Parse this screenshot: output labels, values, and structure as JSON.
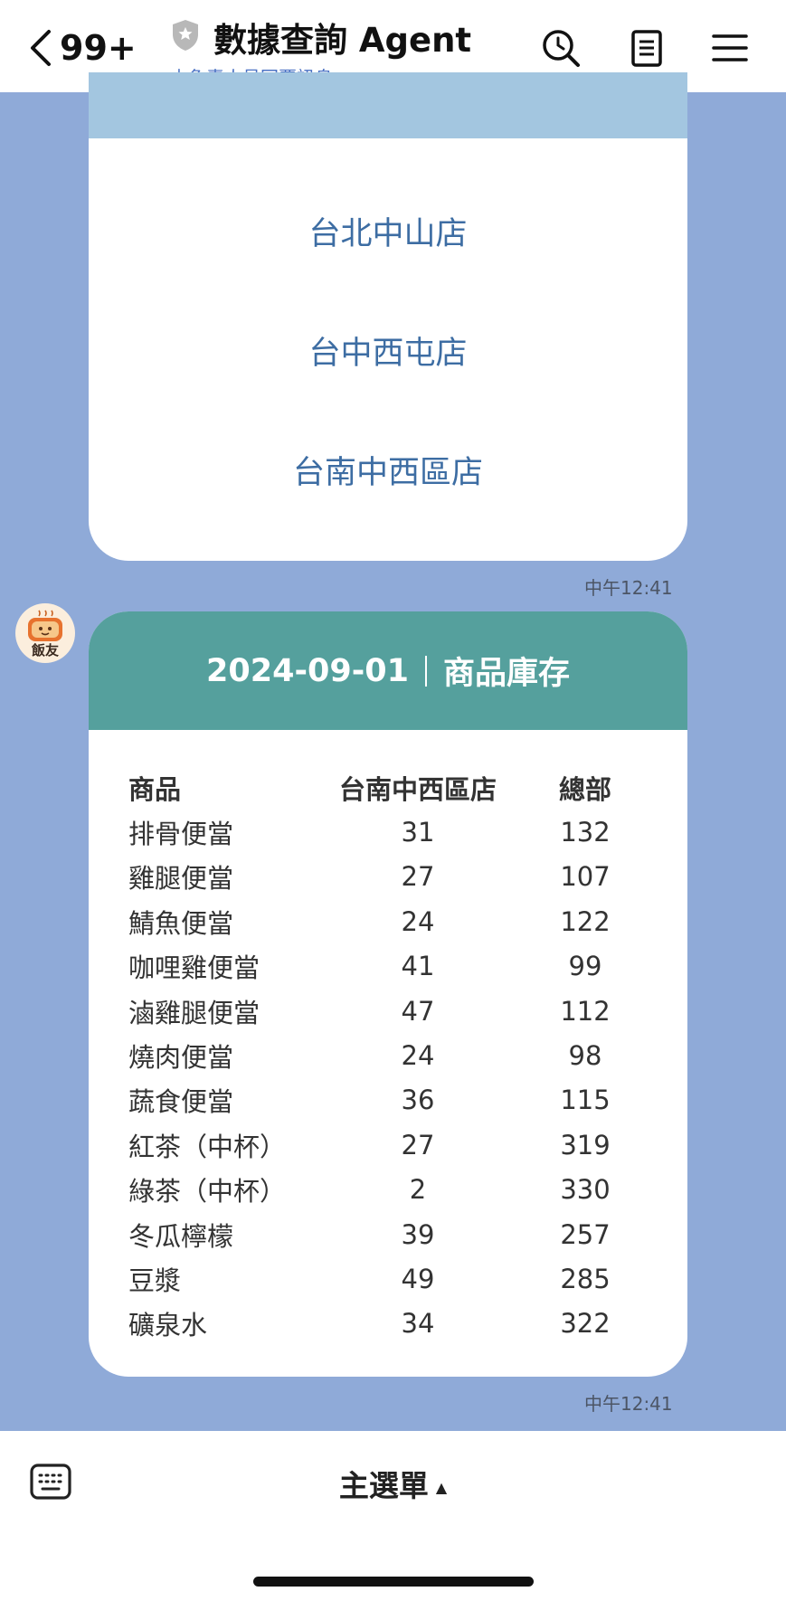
{
  "header": {
    "back_count": "99+",
    "title": "數據查詢 Agent",
    "subtitle": "由負責人員回覆訊息"
  },
  "store_list": {
    "items": [
      "台北中山店",
      "台中西屯店",
      "台南中西區店"
    ],
    "time": "中午12:41"
  },
  "inventory": {
    "date": "2024-09-01",
    "title": "商品庫存",
    "columns": [
      "商品",
      "台南中西區店",
      "總部"
    ],
    "rows": [
      [
        "排骨便當",
        "31",
        "132"
      ],
      [
        "雞腿便當",
        "27",
        "107"
      ],
      [
        "鯖魚便當",
        "24",
        "122"
      ],
      [
        "咖哩雞便當",
        "41",
        "99"
      ],
      [
        "滷雞腿便當",
        "47",
        "112"
      ],
      [
        "燒肉便當",
        "24",
        "98"
      ],
      [
        "蔬食便當",
        "36",
        "115"
      ],
      [
        "紅茶（中杯）",
        "27",
        "319"
      ],
      [
        "綠茶（中杯）",
        "2",
        "330"
      ],
      [
        "冬瓜檸檬",
        "39",
        "257"
      ],
      [
        "豆漿",
        "49",
        "285"
      ],
      [
        "礦泉水",
        "34",
        "322"
      ]
    ],
    "time": "中午12:41"
  },
  "avatar": {
    "label": "飯友"
  },
  "bottom": {
    "menu_label": "主選單"
  },
  "colors": {
    "chat_bg": "#8faad8",
    "header_band": "#55a09d",
    "store_text": "#3d6da3",
    "subtitle": "#4b72c4"
  }
}
